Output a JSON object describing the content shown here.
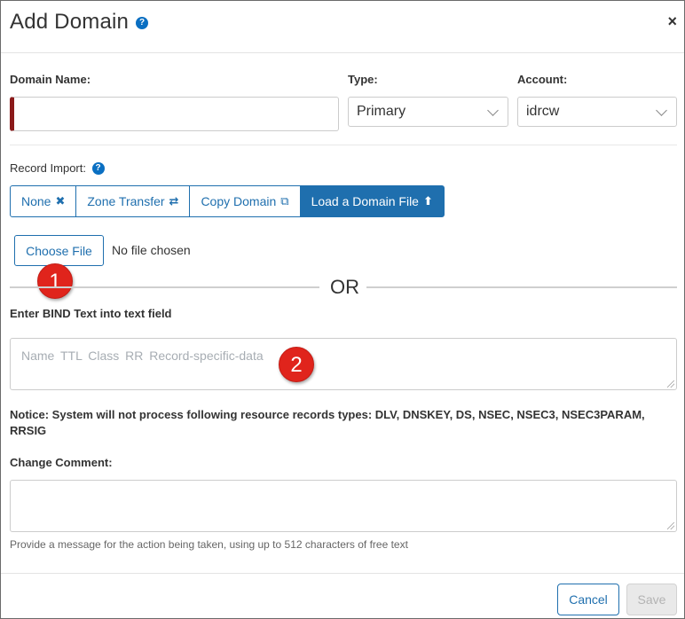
{
  "dialog": {
    "title": "Add Domain",
    "help_icon": "question-circle-icon",
    "close_icon": "close-icon",
    "close_glyph": "×"
  },
  "fields": {
    "domain_name_label": "Domain Name:",
    "domain_name_value": "",
    "type_label": "Type:",
    "type_value": "Primary",
    "account_label": "Account:",
    "account_value": "idrcw"
  },
  "record_import": {
    "label": "Record Import:",
    "options": [
      {
        "label": "None",
        "glyph": "✖",
        "icon": "times-icon",
        "active": false
      },
      {
        "label": "Zone Transfer",
        "glyph": "⇄",
        "icon": "exchange-icon",
        "active": false
      },
      {
        "label": "Copy Domain",
        "glyph": "⧉",
        "icon": "copy-icon",
        "active": false
      },
      {
        "label": "Load a Domain File",
        "glyph": "⬆",
        "icon": "upload-icon",
        "active": true
      }
    ]
  },
  "file_upload": {
    "button_label": "Choose File",
    "status": "No file chosen"
  },
  "annotations": {
    "badge_1": "1",
    "badge_2": "2",
    "badge_color": "#e0241c"
  },
  "separator_text": "OR",
  "bind_text": {
    "label": "Enter BIND Text into text field",
    "placeholder": "Name  TTL  Class  RR  Record-specific-data"
  },
  "notice": "Notice: System will not process following resource records types: DLV, DNSKEY, DS, NSEC, NSEC3, NSEC3PARAM, RRSIG",
  "change_comment": {
    "label": "Change Comment:",
    "value": "",
    "hint": "Provide a message for the action being taken, using up to 512 characters of free text"
  },
  "footer": {
    "cancel_label": "Cancel",
    "save_label": "Save"
  },
  "colors": {
    "accent": "#1f6fae",
    "required_marker": "#8b1a1a",
    "help_icon": "#0a6fc2"
  }
}
